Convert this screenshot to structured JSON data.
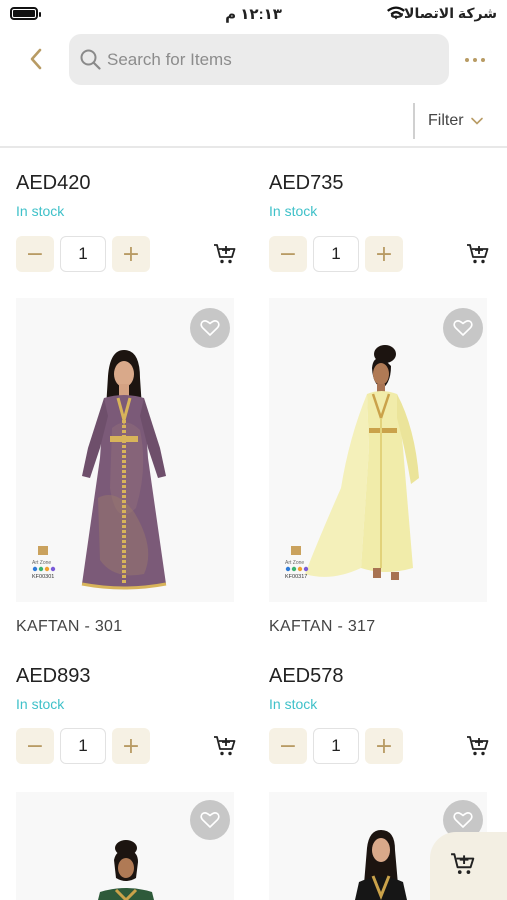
{
  "status_bar": {
    "time": "١٢:١٣ م",
    "carrier": "شركة الاتصالات"
  },
  "header": {
    "search_placeholder": "Search for Items"
  },
  "filter": {
    "label": "Filter"
  },
  "products": [
    {
      "name": "",
      "price": "AED420",
      "stock": "In stock",
      "qty": "1"
    },
    {
      "name": "",
      "price": "AED735",
      "stock": "In stock",
      "qty": "1"
    },
    {
      "name": "KAFTAN - 301",
      "price": "AED893",
      "stock": "In stock",
      "qty": "1",
      "image_code": "KF00301"
    },
    {
      "name": "KAFTAN - 317",
      "price": "AED578",
      "stock": "In stock",
      "qty": "1",
      "image_code": "KF00317"
    }
  ],
  "colors": {
    "accent": "#b89b64",
    "stock": "#3fc1c9",
    "stepper_bg": "#f6f1e4",
    "search_bg": "#ebebeb",
    "heart_bg": "#c7c7c7",
    "dress_301": "#7b5a78",
    "dress_317": "#f1ecaa"
  },
  "icons": {
    "back": "chevron-left-icon",
    "search": "search-icon",
    "more": "more-dots-icon",
    "filter": "chevron-down-icon",
    "cart": "add-to-cart-icon",
    "heart": "heart-icon"
  }
}
